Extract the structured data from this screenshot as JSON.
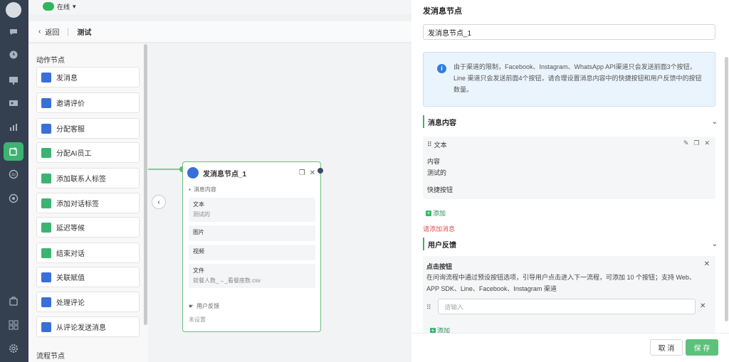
{
  "status": {
    "label": "在线"
  },
  "breadcrumb": {
    "back_label": "返回",
    "title": "测试"
  },
  "palette": {
    "action_section": "动作节点",
    "flow_section": "流程节点",
    "items": [
      {
        "label": "发消息",
        "icon": "send-message-icon"
      },
      {
        "label": "邀请评价",
        "icon": "thumbs-up-icon"
      },
      {
        "label": "分配客服",
        "icon": "assign-agent-icon"
      },
      {
        "label": "分配AI员工",
        "icon": "assign-ai-icon"
      },
      {
        "label": "添加联系人标签",
        "icon": "contact-tag-icon"
      },
      {
        "label": "添加对话标签",
        "icon": "conversation-tag-icon"
      },
      {
        "label": "延迟等候",
        "icon": "delay-icon"
      },
      {
        "label": "结束对话",
        "icon": "end-conversation-icon"
      },
      {
        "label": "关联赋值",
        "icon": "assign-value-icon"
      },
      {
        "label": "处理评论",
        "icon": "comment-icon"
      },
      {
        "label": "从评论发送消息",
        "icon": "comment-message-icon"
      }
    ]
  },
  "node": {
    "title": "发消息节点_1",
    "content_label": "消息内容",
    "blocks": [
      {
        "title": "文本",
        "value": "测试的"
      },
      {
        "title": "图片",
        "value": ""
      },
      {
        "title": "视频",
        "value": ""
      },
      {
        "title": "文件",
        "value": "就餐人数_→_看餐座数.csv"
      }
    ],
    "feedback_label": "用户反馈",
    "feedback_value": "未设置"
  },
  "drawer": {
    "title": "发消息节点",
    "name_value": "发消息节点_1",
    "alert": "由于渠道的限制，Facebook、Instagram、WhatsApp API渠道只会发送前面3个按钮，Line 渠道只会发送前面4个按钮，请合理设置消息内容中的快捷按钮和用户反馈中的按钮数量。",
    "message_section": "消息内容",
    "message": {
      "type_label": "文本",
      "field_content": "内容",
      "content_value": "测试的",
      "field_quick": "快捷按钮"
    },
    "add_label": "添加",
    "error_text": "请添加消息",
    "feedback_section": "用户反馈",
    "feedback": {
      "title": "点击按钮",
      "desc": "在问询流程中通过预设按钮选项，引导用户点击进入下一流程，可添加 10 个按钮；支持 Web、APP SDK、Line、Facebook、Instagram 渠道",
      "input_placeholder": "请输入",
      "add_label": "添加"
    },
    "cancel_label": "取 消",
    "save_label": "保 存"
  },
  "colors": {
    "accent": "#3cb371",
    "primary_blue": "#2f7de1",
    "error": "#e05050"
  }
}
